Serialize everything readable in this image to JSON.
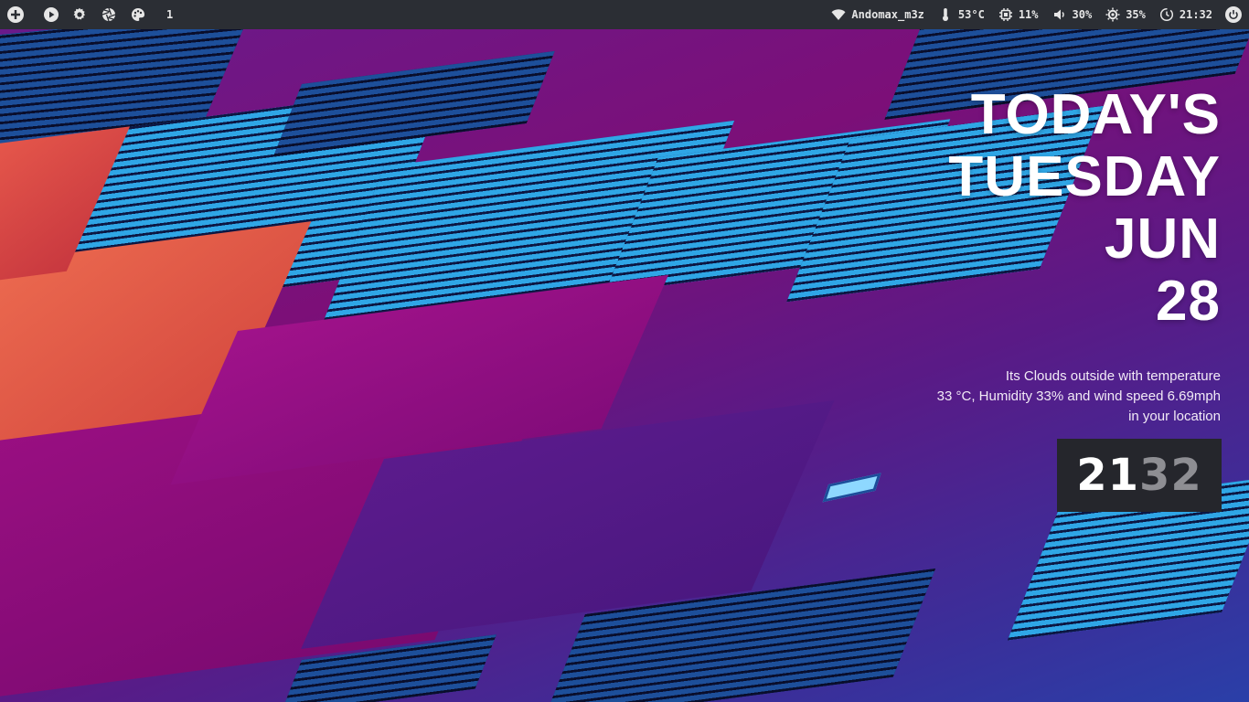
{
  "topbar": {
    "left_icons": [
      "add-icon",
      "play-icon",
      "gear-icon",
      "aperture-icon",
      "palette-icon"
    ],
    "workspace": "1",
    "network": {
      "icon": "wifi-icon",
      "label": "Andomax_m3z"
    },
    "temperature": {
      "icon": "thermometer-icon",
      "label": "53°C"
    },
    "cpu": {
      "icon": "cpu-icon",
      "label": "11%"
    },
    "volume": {
      "icon": "volume-icon",
      "label": "30%"
    },
    "brightness": {
      "icon": "brightness-icon",
      "label": "35%"
    },
    "time": {
      "icon": "clock-icon",
      "label": "21:32"
    },
    "power_icon": "power-icon"
  },
  "widget": {
    "headline": [
      "TODAY'S",
      "TUESDAY",
      "JUN",
      "28"
    ],
    "weather": [
      "Its Clouds outside with temperature",
      "33 °C, Humidity 33% and wind speed 6.69mph",
      "in your location"
    ],
    "clock": {
      "hours": "21",
      "minutes": "32"
    }
  },
  "colors": {
    "bar_bg": "#2b2e34",
    "bar_fg": "#e6e6e6",
    "clock_box_bg": "#25262c",
    "clock_minutes": "#8e8e93",
    "headline": "#ffffff"
  }
}
